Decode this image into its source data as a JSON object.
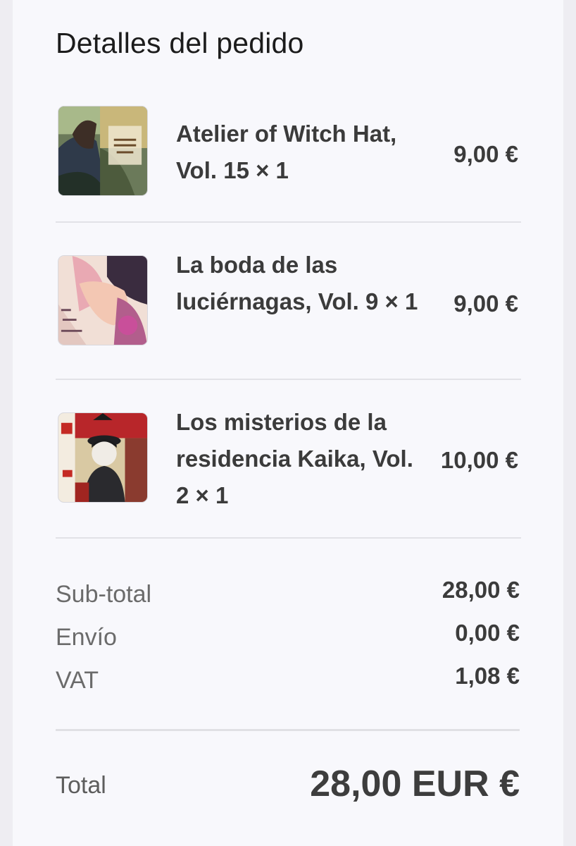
{
  "order": {
    "title": "Detalles del pedido",
    "items": [
      {
        "name": "Atelier of Witch Hat, Vol. 15 × 1",
        "price": "9,00 €",
        "cover_icon": "atelier-of-witch-hat-cover-image"
      },
      {
        "name": "La boda de las luciérnagas, Vol. 9 × 1",
        "price": "9,00 €",
        "cover_icon": "la-boda-de-las-luciernagas-cover-image"
      },
      {
        "name": "Los misterios de la residencia Kaika, Vol. 2 × 1",
        "price": "10,00 €",
        "cover_icon": "los-misterios-de-la-residencia-kaika-cover-image"
      }
    ],
    "summary": {
      "subtotal_label": "Sub-total",
      "subtotal_value": "28,00 €",
      "shipping_label": "Envío",
      "shipping_value": "0,00 €",
      "vat_label": "VAT",
      "vat_value": "1,08 €"
    },
    "total": {
      "label": "Total",
      "value": "28,00 EUR €"
    }
  }
}
